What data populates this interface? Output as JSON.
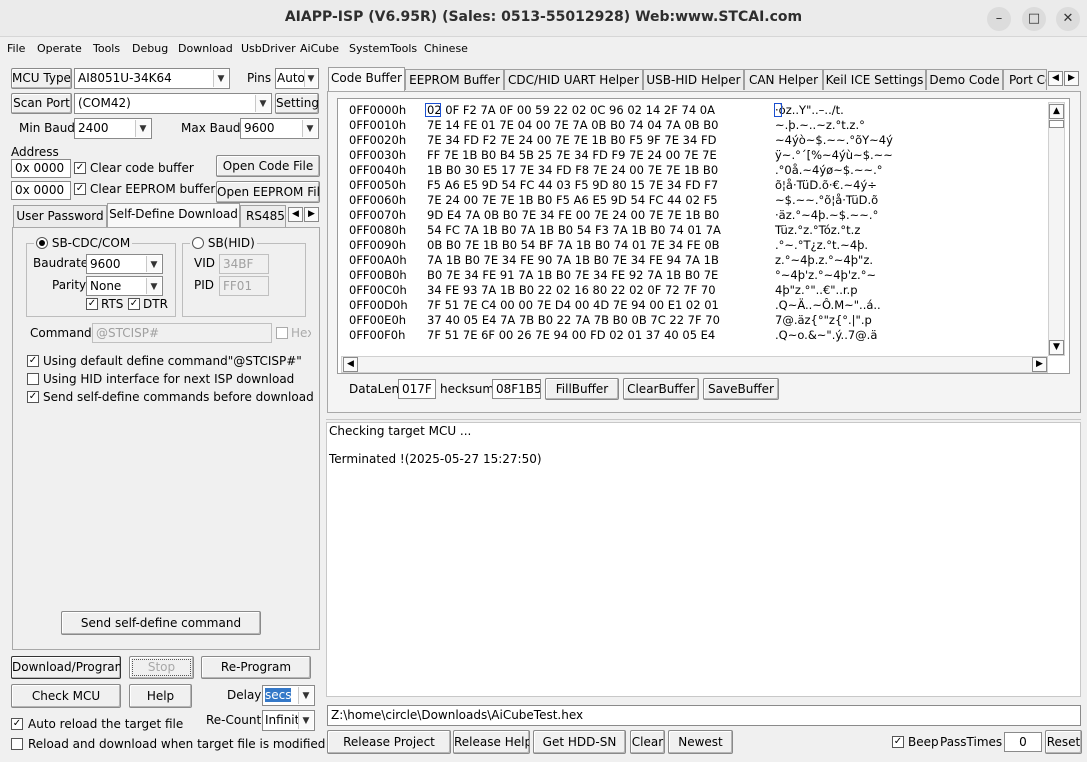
{
  "window": {
    "title": "AIAPP-ISP (V6.95R) (Sales: 0513-55012928) Web:www.STCAI.com",
    "controls": [
      "–",
      "□",
      "✕"
    ]
  },
  "menu": [
    "File",
    "Operate",
    "Tools",
    "Debug",
    "Download",
    "UsbDriver",
    "AiCube",
    "SystemTools",
    "Chinese"
  ],
  "left": {
    "mcu_type_label": "MCU Type",
    "mcu_type_value": "AI8051U-34K64",
    "pins_label": "Pins",
    "pins_value": "Auto",
    "scan_port_label": "Scan Port",
    "scan_port_value": "(COM42)",
    "setting_label": "Setting",
    "min_baud_label": "Min Baud",
    "min_baud_value": "2400",
    "max_baud_label": "Max Baud",
    "max_baud_value": "9600",
    "address_label": "Address",
    "addr1_value": "0x 0000",
    "clear_code_label": "Clear code buffer",
    "open_code_label": "Open Code File",
    "addr2_value": "0x 0000",
    "clear_eeprom_label": "Clear EEPROM buffer",
    "open_eeprom_label": "Open EEPROM File",
    "tabs": [
      "User Password",
      "Self-Define Download",
      "RS485"
    ],
    "sb_cdc_label": "SB-CDC/COM",
    "sb_hid_label": "SB(HID)",
    "baudrate_label": "Baudrate",
    "baudrate_value": "9600",
    "parity_label": "Parity",
    "parity_value": "None",
    "rts_label": "RTS",
    "dtr_label": "DTR",
    "vid_label": "VID",
    "vid_value": "34BF",
    "pid_label": "PID",
    "pid_value": "FF01",
    "command_label": "Command",
    "command_placeholder": "@STCISP#",
    "hex_label": "Hex",
    "opt1": "Using default define command\"@STCISP#\"",
    "opt2": "Using HID interface for next ISP download",
    "opt3": "Send self-define commands before download",
    "send_cmd_label": "Send self-define command",
    "download_label": "Download/Program",
    "stop_label": "Stop",
    "reprogram_label": "Re-Program",
    "check_mcu_label": "Check MCU",
    "help_label": "Help",
    "delay_label": "Delay",
    "delay_value": "secs",
    "recount_label": "Re-Count",
    "recount_value": "Infinite",
    "auto_reload_label": "Auto reload the target file",
    "reload_modified_label": "Reload and download when target file is modified"
  },
  "right": {
    "tabs": [
      "Code Buffer",
      "EEPROM Buffer",
      "CDC/HID UART Helper",
      "USB-HID Helper",
      "CAN Helper",
      "Keil ICE Settings",
      "Demo Code",
      "Port Co"
    ],
    "hex_rows": [
      {
        "addr": "0FF0000h",
        "bytes": "02 0F F2 7A 0F 00 59 22 02 0C 96 02 14 2F 74 0A",
        "ascii": "·òz..Y\"..–../t."
      },
      {
        "addr": "0FF0010h",
        "bytes": "7E 14 FE 01 7E 04 00 7E 7A 0B B0 74 04 7A 0B B0",
        "ascii": "~.þ.~..~z.°t.z.°"
      },
      {
        "addr": "0FF0020h",
        "bytes": "7E 34 FD F2 7E 24 00 7E 7E 1B B0 F5 9F 7E 34 FD",
        "ascii": "~4ýò~$.~~.°õY~4ý"
      },
      {
        "addr": "0FF0030h",
        "bytes": "FF 7E 1B B0 B4 5B 25 7E 34 FD F9 7E 24 00 7E 7E",
        "ascii": "ÿ~.°´[%~4ýù~$.~~"
      },
      {
        "addr": "0FF0040h",
        "bytes": "1B B0 30 E5 17 7E 34 FD F8 7E 24 00 7E 7E 1B B0",
        "ascii": ".°0å.~4ýø~$.~~.°"
      },
      {
        "addr": "0FF0050h",
        "bytes": "F5 A6 E5 9D 54 FC 44 03 F5 9D 80 15 7E 34 FD F7",
        "ascii": "õ¦å·TüD.õ·€.~4ý÷"
      },
      {
        "addr": "0FF0060h",
        "bytes": "7E 24 00 7E 7E 1B B0 F5 A6 E5 9D 54 FC 44 02 F5",
        "ascii": "~$.~~.°õ¦å·TüD.õ"
      },
      {
        "addr": "0FF0070h",
        "bytes": "9D E4 7A 0B B0 7E 34 FE 00 7E 24 00 7E 7E 1B B0",
        "ascii": "·äz.°~4þ.~$.~~.°"
      },
      {
        "addr": "0FF0080h",
        "bytes": "54 FC 7A 1B B0 7A 1B B0 54 F3 7A 1B B0 74 01 7A",
        "ascii": "Tüz.°z.°Tóz.°t.z"
      },
      {
        "addr": "0FF0090h",
        "bytes": "0B B0 7E 1B B0 54 BF 7A 1B B0 74 01 7E 34 FE 0B",
        "ascii": ".°~.°T¿z.°t.~4þ."
      },
      {
        "addr": "0FF00A0h",
        "bytes": "7A 1B B0 7E 34 FE 90 7A 1B B0 7E 34 FE 94 7A 1B",
        "ascii": "z.°~4þ.z.°~4þ\"z."
      },
      {
        "addr": "0FF00B0h",
        "bytes": "B0 7E 34 FE 91 7A 1B B0 7E 34 FE 92 7A 1B B0 7E",
        "ascii": "°~4þ'z.°~4þ'z.°~"
      },
      {
        "addr": "0FF00C0h",
        "bytes": "34 FE 93 7A 1B B0 22 02 16 80 22 02 0F 72 7F 70",
        "ascii": "4þ\"z.°\"..€\"..r.p"
      },
      {
        "addr": "0FF00D0h",
        "bytes": "7F 51 7E C4 00 00 7E D4 00 4D 7E 94 00 E1 02 01",
        "ascii": ".Q~Ä..~Ô.M~\"..á.."
      },
      {
        "addr": "0FF00E0h",
        "bytes": "37 40 05 E4 7A 7B B0 22 7A 7B B0 0B 7C 22 7F 70",
        "ascii": "7@.äz{°\"z{°.|\".p"
      },
      {
        "addr": "0FF00F0h",
        "bytes": "7F 51 7E 6F 00 26 7E 94 00 FD 02 01 37 40 05 E4",
        "ascii": ".Q~o.&~\".ý..7@.ä"
      }
    ],
    "datalen_label": "DataLen",
    "datalen_value": "017F",
    "checksum_label": "hecksum",
    "checksum_value": "08F1B5",
    "fill_label": "FillBuffer",
    "clear_label": "ClearBuffer",
    "save_label": "SaveBuffer",
    "log_line1": "Checking target MCU ...",
    "log_line2": "Terminated !(2025-05-27 15:27:50)",
    "file_path": "Z:\\home\\circle\\Downloads\\AiCubeTest.hex",
    "release_project_label": "Release Project",
    "release_help_label": "Release Help",
    "get_hdd_label": "Get HDD-SN",
    "clear_btn_label": "Clear",
    "newest_label": "Newest",
    "beep_label": "Beep",
    "pass_times_label": "PassTimes",
    "pass_times_value": "0",
    "reset_label": "Reset"
  }
}
